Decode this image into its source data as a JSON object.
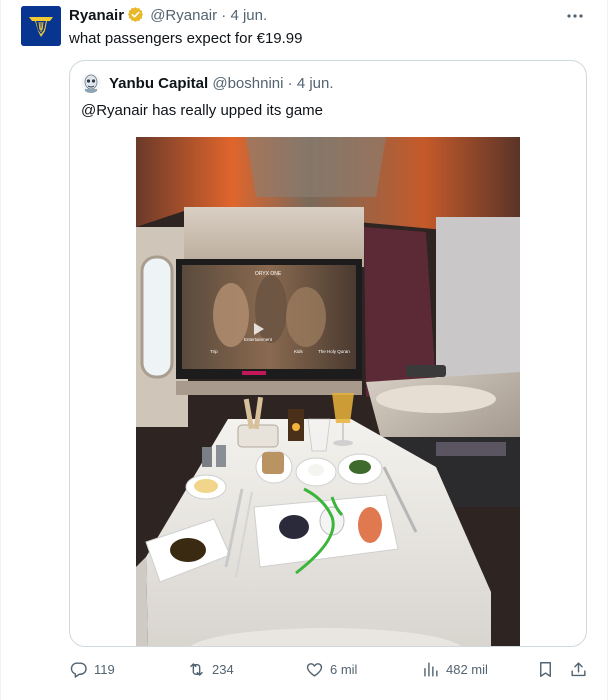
{
  "tweet": {
    "author_name": "Ryanair",
    "author_handle": "@Ryanair",
    "separator": "·",
    "date": "4 jun.",
    "text": "what passengers expect for €19.99"
  },
  "quoted_tweet": {
    "author_name": "Yanbu Capital",
    "author_handle": "@boshnini",
    "separator": "·",
    "date": "4 jun.",
    "text": "@Ryanair has really upped its game"
  },
  "screen_captions": {
    "brand": "ORYX ONE",
    "item1": "Trip",
    "item2": "Entertainment",
    "item3": "Kids",
    "item4": "The Holy Quran"
  },
  "actions": {
    "replies": "119",
    "reposts": "234",
    "likes": "6 mil",
    "views": "482 mil"
  },
  "icons": {
    "more": "more-dots-icon",
    "verified": "verified-badge-icon",
    "reply": "reply-icon",
    "repost": "repost-icon",
    "like": "heart-icon",
    "views": "analytics-icon",
    "bookmark": "bookmark-icon",
    "share": "share-icon"
  },
  "colors": {
    "brand_blue": "#073590",
    "brand_gold": "#f1c933",
    "verified_gold": "#e8b829",
    "secondary_text": "#536471",
    "border": "#cfd9de"
  }
}
